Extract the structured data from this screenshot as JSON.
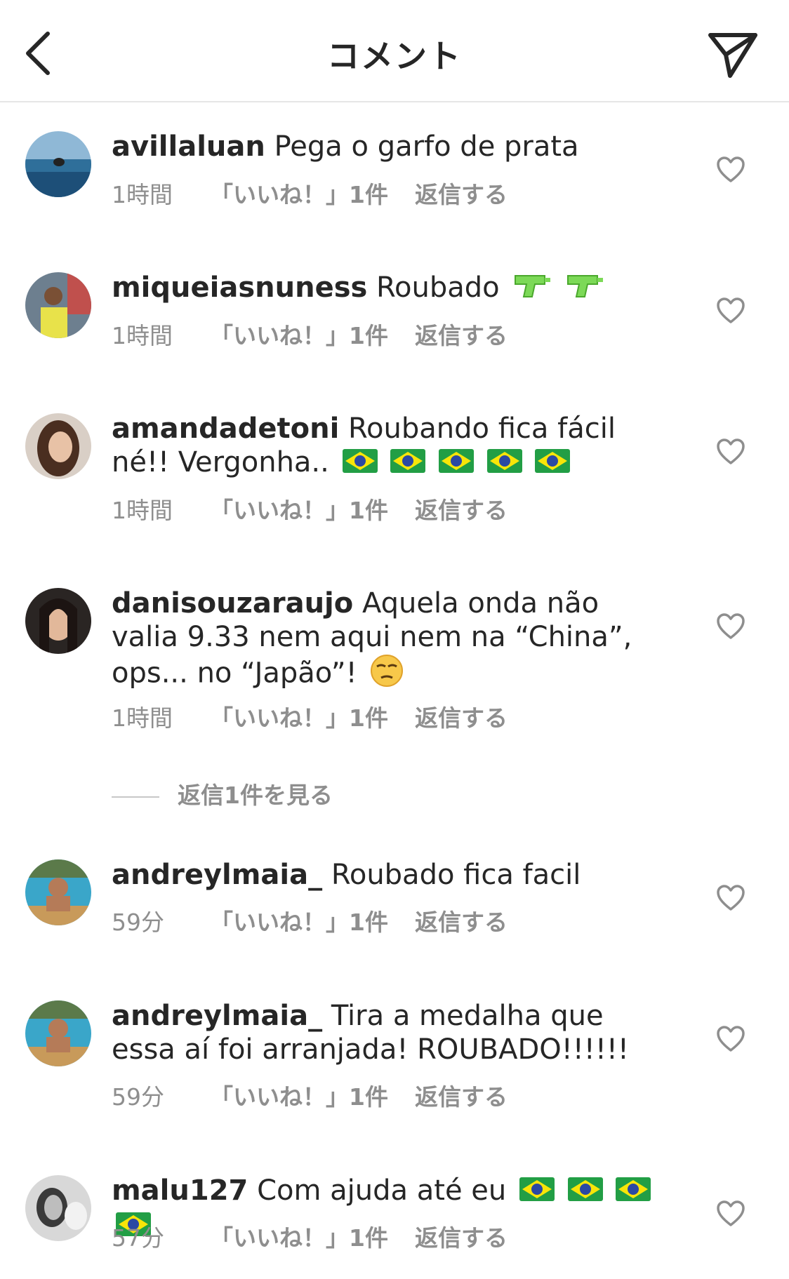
{
  "header": {
    "title": "コメント",
    "back_icon": "chevron-left-icon",
    "send_icon": "paper-plane-icon"
  },
  "comments": [
    {
      "username": "avillaluan",
      "text": "Pega o garfo de prata",
      "time": "1時間",
      "likes": "「いいね！」1件",
      "reply": "返信する"
    },
    {
      "username": "miqueiasnuness",
      "text": "Roubado",
      "emojis": [
        "water-pistol-emoji",
        "water-pistol-emoji"
      ],
      "time": "1時間",
      "likes": "「いいね！」1件",
      "reply": "返信する"
    },
    {
      "username": "amandadetoni",
      "text": "Roubando fica fácil né!! Vergonha..",
      "emojis": [
        "brazil-flag-emoji",
        "brazil-flag-emoji",
        "brazil-flag-emoji",
        "brazil-flag-emoji",
        "brazil-flag-emoji"
      ],
      "time": "1時間",
      "likes": "「いいね！」1件",
      "reply": "返信する"
    },
    {
      "username": "danisouzaraujo",
      "text": "Aquela onda não valia 9.33 nem aqui nem na “China”, ops... no “Japão”!",
      "emojis": [
        "unamused-face-emoji"
      ],
      "time": "1時間",
      "likes": "「いいね！」1件",
      "reply": "返信する"
    },
    {
      "username": "andreylmaia_",
      "text": "Roubado fica facil",
      "time": "59分",
      "likes": "「いいね！」1件",
      "reply": "返信する"
    },
    {
      "username": "andreylmaia_",
      "text": "Tira a medalha que essa aí foi arranjada! ROUBADO!!!!!!",
      "time": "59分",
      "likes": "「いいね！」1件",
      "reply": "返信する"
    },
    {
      "username": "malu127",
      "text": "Com ajuda até eu",
      "emojis": [
        "brazil-flag-emoji",
        "brazil-flag-emoji",
        "brazil-flag-emoji",
        "brazil-flag-emoji"
      ],
      "time": "57分",
      "likes": "「いいね！」1件",
      "reply": "返信する"
    }
  ],
  "view_replies": "返信1件を見る",
  "colors": {
    "text": "#262626",
    "secondary": "#8e8e8e",
    "divider": "#e6e6e6"
  }
}
